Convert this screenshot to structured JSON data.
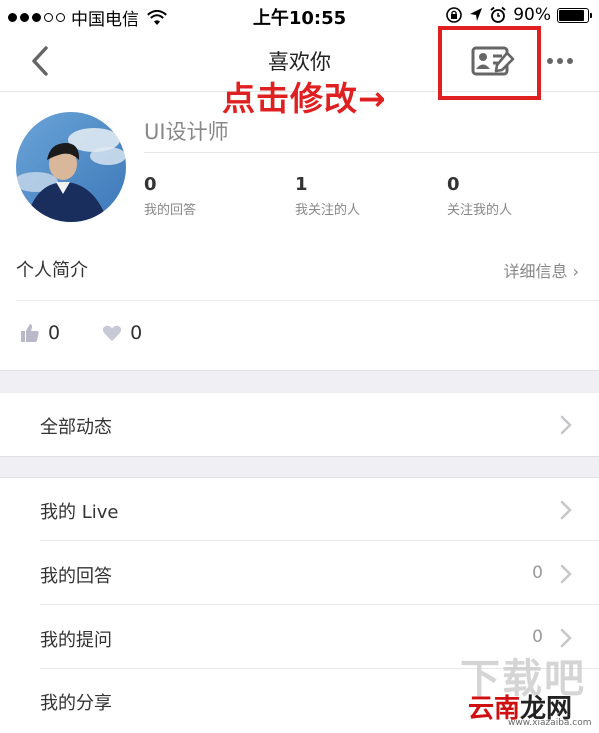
{
  "status_bar": {
    "carrier": "中国电信",
    "time": "上午10:55",
    "battery": "90%"
  },
  "nav": {
    "title": "喜欢你"
  },
  "annotation": {
    "text": "点击修改→"
  },
  "profile": {
    "username": "UI设计师",
    "stats": [
      {
        "count": "0",
        "label": "我的回答"
      },
      {
        "count": "1",
        "label": "我关注的人"
      },
      {
        "count": "0",
        "label": "关注我的人"
      }
    ],
    "intro_label": "个人简介",
    "detail_link": "详细信息 ›",
    "thumbs_count": "0",
    "hearts_count": "0"
  },
  "menu": {
    "all_activity": "全部动态",
    "items": [
      {
        "label": "我的 Live",
        "value": ""
      },
      {
        "label": "我的回答",
        "value": "0"
      },
      {
        "label": "我的提问",
        "value": "0"
      },
      {
        "label": "我的分享",
        "value": ""
      }
    ]
  },
  "watermark": {
    "brand_part1": "云南",
    "brand_part2": "龙网",
    "url": "www.xiazaiba.com",
    "mark": "下载吧"
  },
  "colors": {
    "annotation_red": "#e02020",
    "background_band": "#efeff4",
    "chevron": "#c7c7cc"
  }
}
